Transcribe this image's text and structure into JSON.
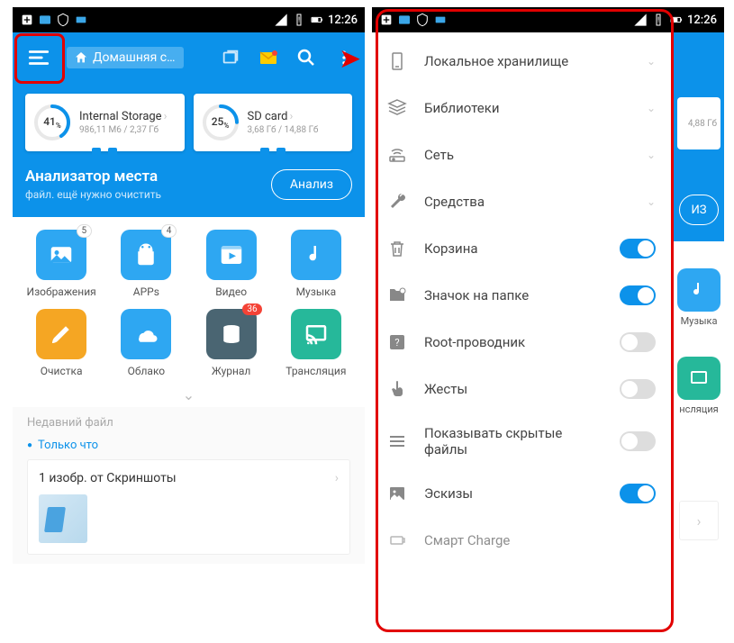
{
  "status": {
    "time": "12:26"
  },
  "toolbar": {
    "breadcrumb": "Домашняя с..."
  },
  "storage": {
    "internal": {
      "title": "Internal Storage",
      "sub": "986,11 М6 / 2,37 Гб",
      "pct": "41",
      "pct_unit": "%"
    },
    "sd": {
      "title": "SD card",
      "sub": "3,68 Гб / 14,88 Гб",
      "pct": "25",
      "pct_unit": "%"
    }
  },
  "analyzer": {
    "title": "Анализатор места",
    "sub": "файл. ещё нужно очистить",
    "btn": "Анализ"
  },
  "grid": {
    "images": {
      "label": "Изображения",
      "badge": "5"
    },
    "apps": {
      "label": "APPs",
      "badge": "4"
    },
    "video": {
      "label": "Видео"
    },
    "music": {
      "label": "Музыка"
    },
    "clean": {
      "label": "Очистка"
    },
    "cloud": {
      "label": "Облако"
    },
    "log": {
      "label": "Журнал",
      "badge": "36"
    },
    "cast": {
      "label": "Трансляция"
    }
  },
  "recent": {
    "header": "Недавний файл",
    "just_now": "Только что",
    "card_title": "1 изобр. от Скриншоты"
  },
  "drawer": {
    "local": "Локальное хранилище",
    "libs": "Библиотеки",
    "net": "Сеть",
    "tools": "Средства",
    "trash": "Корзина",
    "folder_icon": "Значок на папке",
    "root": "Root-проводник",
    "gestures": "Жесты",
    "hidden": "Показывать скрытые файлы",
    "thumbs": "Эскизы",
    "smart": "Смарт Charge"
  },
  "bg_right": {
    "storage_sub": "4,88 Гб",
    "btn_frag": "ИЗ",
    "music": "Музыка",
    "cast": "нсляция"
  }
}
